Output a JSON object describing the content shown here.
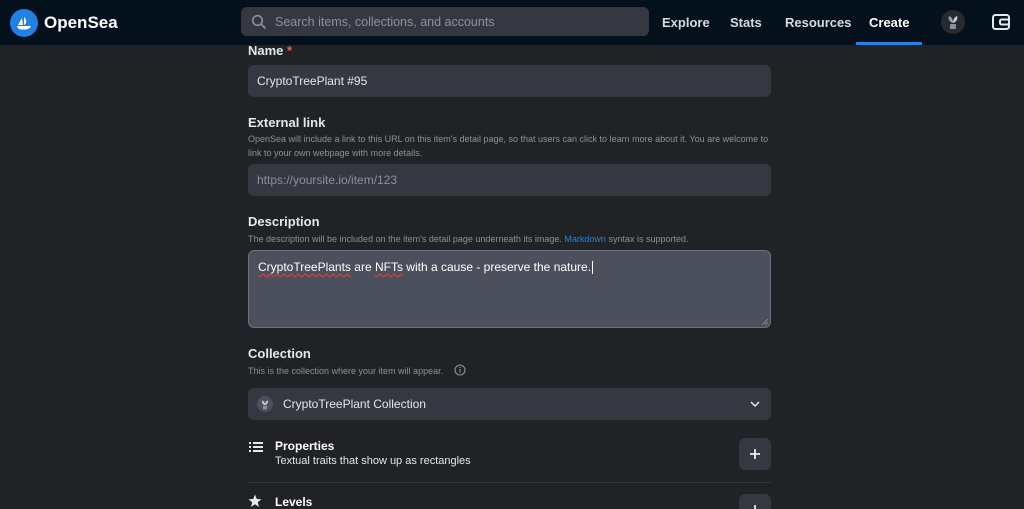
{
  "app": {
    "brand": "OpenSea"
  },
  "nav": {
    "search_placeholder": "Search items, collections, and accounts",
    "links": [
      "Explore",
      "Stats",
      "Resources",
      "Create"
    ],
    "active": "Create"
  },
  "form": {
    "name": {
      "label": "Name",
      "required_mark": "*",
      "value": "CryptoTreePlant #95"
    },
    "external_link": {
      "label": "External link",
      "help": "OpenSea will include a link to this URL on this item's detail page, so that users can click to learn more about it. You are welcome to link to your own webpage with more details.",
      "placeholder": "https://yoursite.io/item/123"
    },
    "description": {
      "label": "Description",
      "help_before": "The description will be included on the item's detail page underneath its image.",
      "help_link": "Markdown",
      "help_after": "syntax is supported.",
      "value_word1": "CryptoTreePlants",
      "value_mid": " are ",
      "value_word2": "NFTs",
      "value_rest": " with a cause - preserve the nature."
    },
    "collection": {
      "label": "Collection",
      "help": "This is the collection where your item will appear.",
      "selected": "CryptoTreePlant Collection"
    },
    "properties": {
      "title": "Properties",
      "subtitle": "Textual traits that show up as rectangles"
    },
    "levels": {
      "title": "Levels"
    }
  },
  "colors": {
    "accent": "#2081e2",
    "background": "#202225",
    "field": "#353840",
    "required": "#eb5757"
  }
}
